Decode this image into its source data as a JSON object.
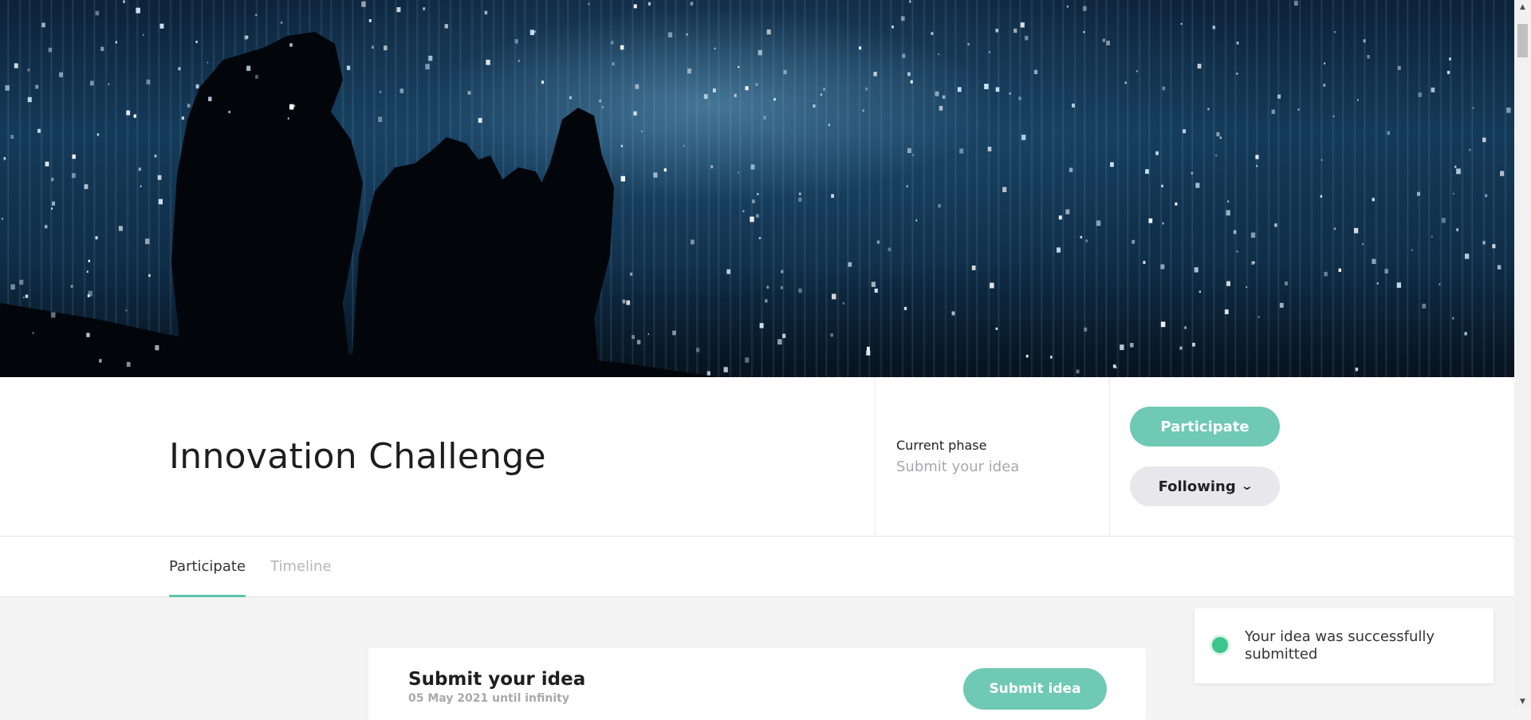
{
  "header": {
    "title": "Innovation Challenge",
    "phase_label": "Current phase",
    "phase_value": "Submit your idea",
    "participate_label": "Participate",
    "following_label": "Following",
    "following_icon": "chevron-down-icon"
  },
  "tabs": [
    {
      "label": "Participate",
      "active": true
    },
    {
      "label": "Timeline",
      "active": false
    }
  ],
  "card": {
    "title": "Submit your idea",
    "date": "05 May 2021 until infinity",
    "submit_label": "Submit idea"
  },
  "toast": {
    "message": "Your idea was successfully submitted",
    "status": "success"
  },
  "colors": {
    "accent": "#6fc9b4",
    "success": "#3cc58c",
    "secondary_button": "#e8e8ec"
  }
}
